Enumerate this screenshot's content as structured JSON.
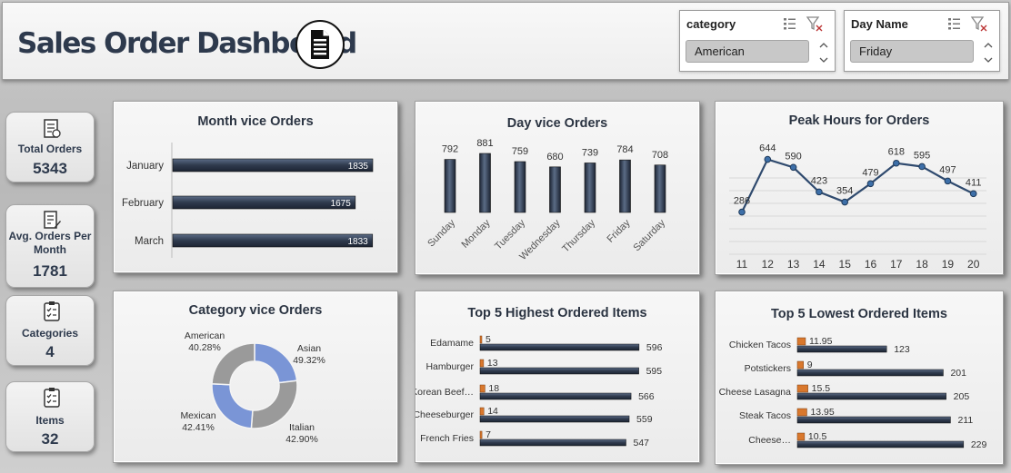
{
  "header": {
    "title": "Sales Order Dashboard",
    "title_icon": "document-icon"
  },
  "slicers": [
    {
      "title": "category",
      "selected": "American",
      "icons": [
        "multi-select-icon",
        "clear-filter-icon"
      ]
    },
    {
      "title": "Day Name",
      "selected": "Friday",
      "icons": [
        "multi-select-icon",
        "clear-filter-icon"
      ]
    }
  ],
  "kpis": [
    {
      "label": "Total Orders",
      "value": "5343",
      "icon": "invoice-icon"
    },
    {
      "label": "Avg. Orders Per Month",
      "value": "1781",
      "icon": "clipboard-edit-icon"
    },
    {
      "label": "Categories",
      "value": "4",
      "icon": "checklist-icon"
    },
    {
      "label": "Items",
      "value": "32",
      "icon": "checklist-icon"
    }
  ],
  "colors": {
    "bar": "#2f3a4d",
    "bar_highlight": "#5b6c86",
    "accent_orange": "#d9782d",
    "line": "#2f4a6e",
    "donut_blue": "#7a95d6",
    "donut_grey": "#9a9a9a"
  },
  "chart_data": [
    {
      "id": "month",
      "type": "bar",
      "orientation": "horizontal",
      "title": "Month vice Orders",
      "categories": [
        "January",
        "February",
        "March"
      ],
      "values": [
        1835,
        1675,
        1833
      ],
      "data_labels": [
        "1835",
        "1675",
        "1833"
      ],
      "xlim": [
        0,
        1835
      ]
    },
    {
      "id": "day",
      "type": "bar",
      "title": "Day vice Orders",
      "categories": [
        "Sunday",
        "Monday",
        "Tuesday",
        "Wednesday",
        "Thursday",
        "Friday",
        "Saturday"
      ],
      "values": [
        792,
        881,
        759,
        680,
        739,
        784,
        708
      ],
      "data_labels": [
        "792",
        "881",
        "759",
        "680",
        "739",
        "784",
        "708"
      ],
      "ylim": [
        0,
        881
      ]
    },
    {
      "id": "hours",
      "type": "line",
      "title": "Peak Hours for Orders",
      "x": [
        "11",
        "12",
        "13",
        "14",
        "15",
        "16",
        "17",
        "18",
        "19",
        "20"
      ],
      "values": [
        286,
        644,
        590,
        423,
        354,
        479,
        618,
        595,
        497,
        411
      ],
      "data_labels": [
        "286",
        "644",
        "590",
        "423",
        "354",
        "479",
        "618",
        "595",
        "497",
        "411"
      ],
      "grid": true
    },
    {
      "id": "category",
      "type": "pie",
      "variant": "donut",
      "title": "Category vice Orders",
      "categories": [
        "American",
        "Asian",
        "Italian",
        "Mexican"
      ],
      "values": [
        40.28,
        49.32,
        42.9,
        42.41
      ],
      "data_labels": [
        "40.28%",
        "49.32%",
        "42.90%",
        "42.41%"
      ]
    },
    {
      "id": "top5high",
      "type": "bar",
      "orientation": "horizontal",
      "title": "Top 5 Highest Ordered Items",
      "categories": [
        "Edamame",
        "Hamburger",
        "Korean Beef…",
        "Cheeseburger",
        "French Fries"
      ],
      "series": [
        {
          "values": [
            5,
            13,
            18,
            14,
            7
          ],
          "data_labels": [
            "5",
            "13",
            "18",
            "14",
            "7"
          ]
        },
        {
          "values": [
            596,
            595,
            566,
            559,
            547
          ],
          "data_labels": [
            "596",
            "595",
            "566",
            "559",
            "547"
          ]
        }
      ],
      "xlim": [
        0,
        610
      ]
    },
    {
      "id": "top5low",
      "type": "bar",
      "orientation": "horizontal",
      "title": "Top 5 Lowest Ordered Items",
      "categories": [
        "Chicken Tacos",
        "Potstickers",
        "Cheese Lasagna",
        "Steak Tacos",
        "Cheese…"
      ],
      "series": [
        {
          "values": [
            11.95,
            9,
            15.5,
            13.95,
            10.5
          ],
          "data_labels": [
            "11.95",
            "9",
            "15.5",
            "13.95",
            "10.5"
          ]
        },
        {
          "values": [
            123,
            201,
            205,
            211,
            229
          ],
          "data_labels": [
            "123",
            "201",
            "205",
            "211",
            "229"
          ]
        }
      ],
      "xlim": [
        0,
        238
      ]
    }
  ]
}
